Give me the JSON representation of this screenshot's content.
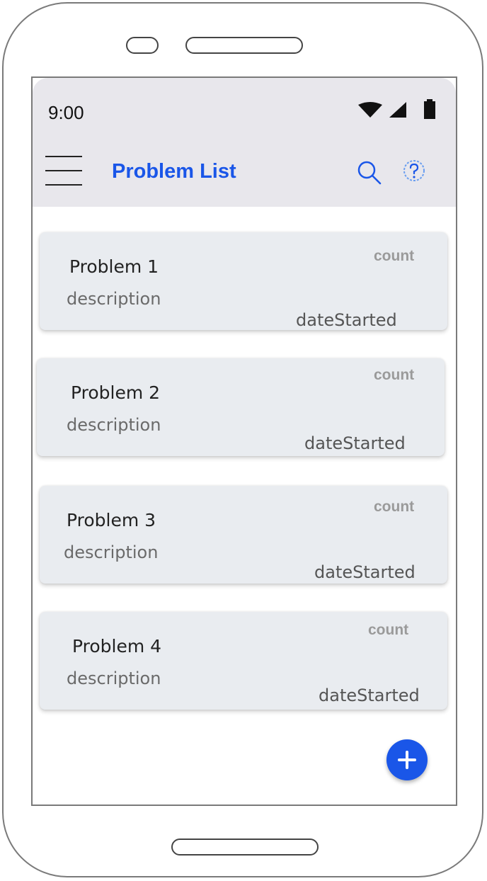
{
  "status_bar": {
    "time": "9:00"
  },
  "app_bar": {
    "title": "Problem List",
    "icons": [
      "menu-icon",
      "search-icon",
      "help-icon"
    ],
    "title_color": "#1a56e8",
    "background": "#e8e7ec"
  },
  "problems": [
    {
      "title": "Problem 1",
      "description": "description",
      "count": "count",
      "date": "dateStarted"
    },
    {
      "title": "Problem 2",
      "description": "description",
      "count": "count",
      "date": "dateStarted"
    },
    {
      "title": "Problem 3",
      "description": "description",
      "count": "count",
      "date": "dateStarted"
    },
    {
      "title": "Problem 4",
      "description": "description",
      "count": "count",
      "date": "dateStarted"
    }
  ],
  "fab": {
    "icon": "plus-icon",
    "color": "#1a56e8"
  }
}
